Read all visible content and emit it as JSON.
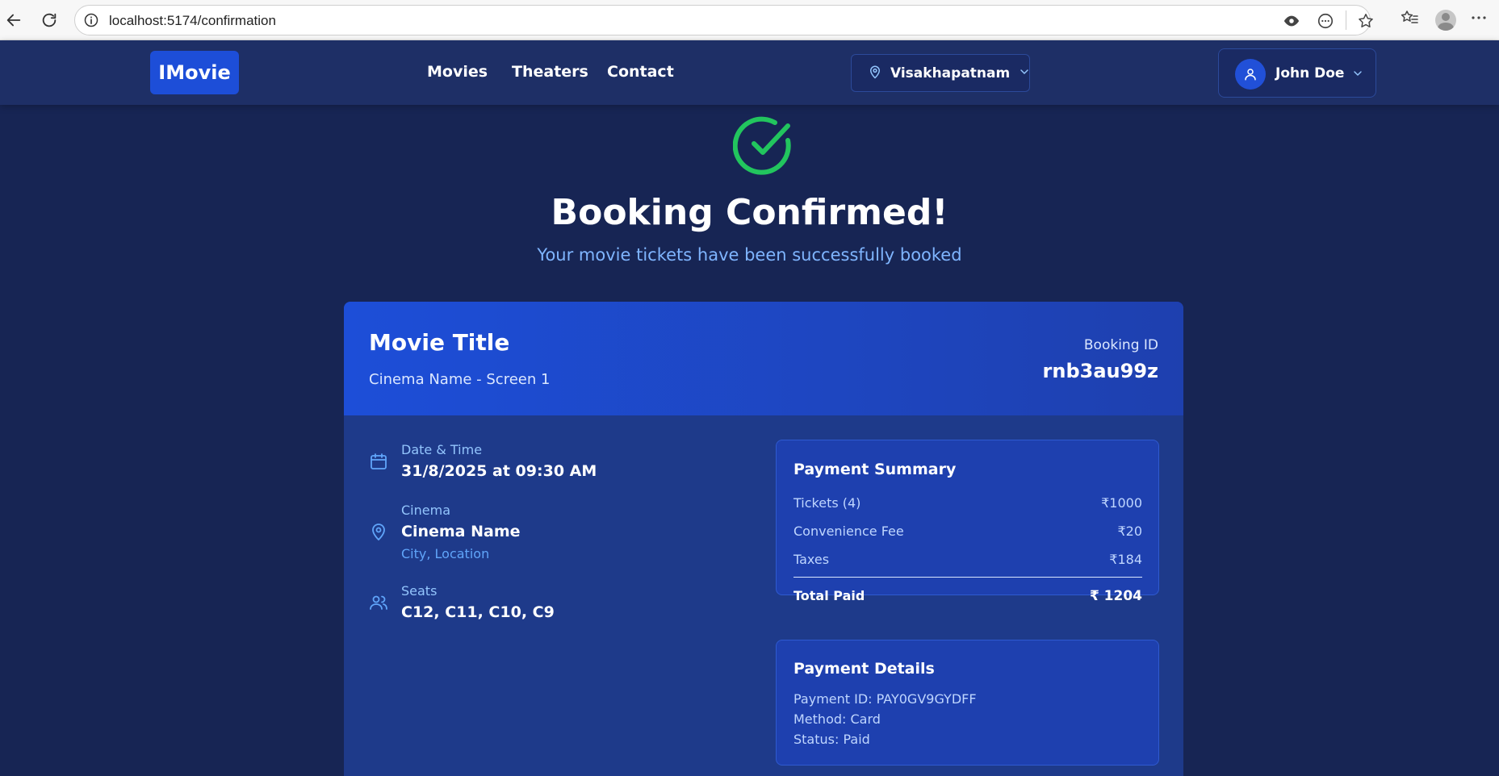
{
  "browser": {
    "url": "localhost:5174/confirmation"
  },
  "header": {
    "logo": "IMovie",
    "nav": [
      {
        "label": "Movies"
      },
      {
        "label": "Theaters"
      },
      {
        "label": "Contact"
      }
    ],
    "location": "Visakhapatnam",
    "user_name": "John Doe"
  },
  "hero": {
    "title": "Booking Confirmed!",
    "subtitle": "Your movie tickets have been successfully booked"
  },
  "booking": {
    "movie_title": "Movie Title",
    "cinema_screen": "Cinema Name - Screen 1",
    "booking_id_label": "Booking ID",
    "booking_id": "rnb3au99z",
    "date_label": "Date & Time",
    "date_value": "31/8/2025 at 09:30 AM",
    "cinema_label": "Cinema",
    "cinema_value": "Cinema Name",
    "cinema_location": "City, Location",
    "seats_label": "Seats",
    "seats_value": "C12, C11, C10, C9"
  },
  "payment_summary": {
    "title": "Payment Summary",
    "rows": [
      {
        "label": "Tickets (4)",
        "amount": "₹1000"
      },
      {
        "label": "Convenience Fee",
        "amount": "₹20"
      },
      {
        "label": "Taxes",
        "amount": "₹184"
      }
    ],
    "total_label": "Total Paid",
    "total_amount": "₹  1204"
  },
  "payment_details": {
    "title": "Payment Details",
    "payment_id": "Payment ID: PAY0GV9GYDFF",
    "method": "Method: Card",
    "status": "Status: Paid"
  },
  "colors": {
    "background": "#172554",
    "accent": "#1d4ed8",
    "success": "#22c55e",
    "muted_text": "#93c5fd"
  }
}
